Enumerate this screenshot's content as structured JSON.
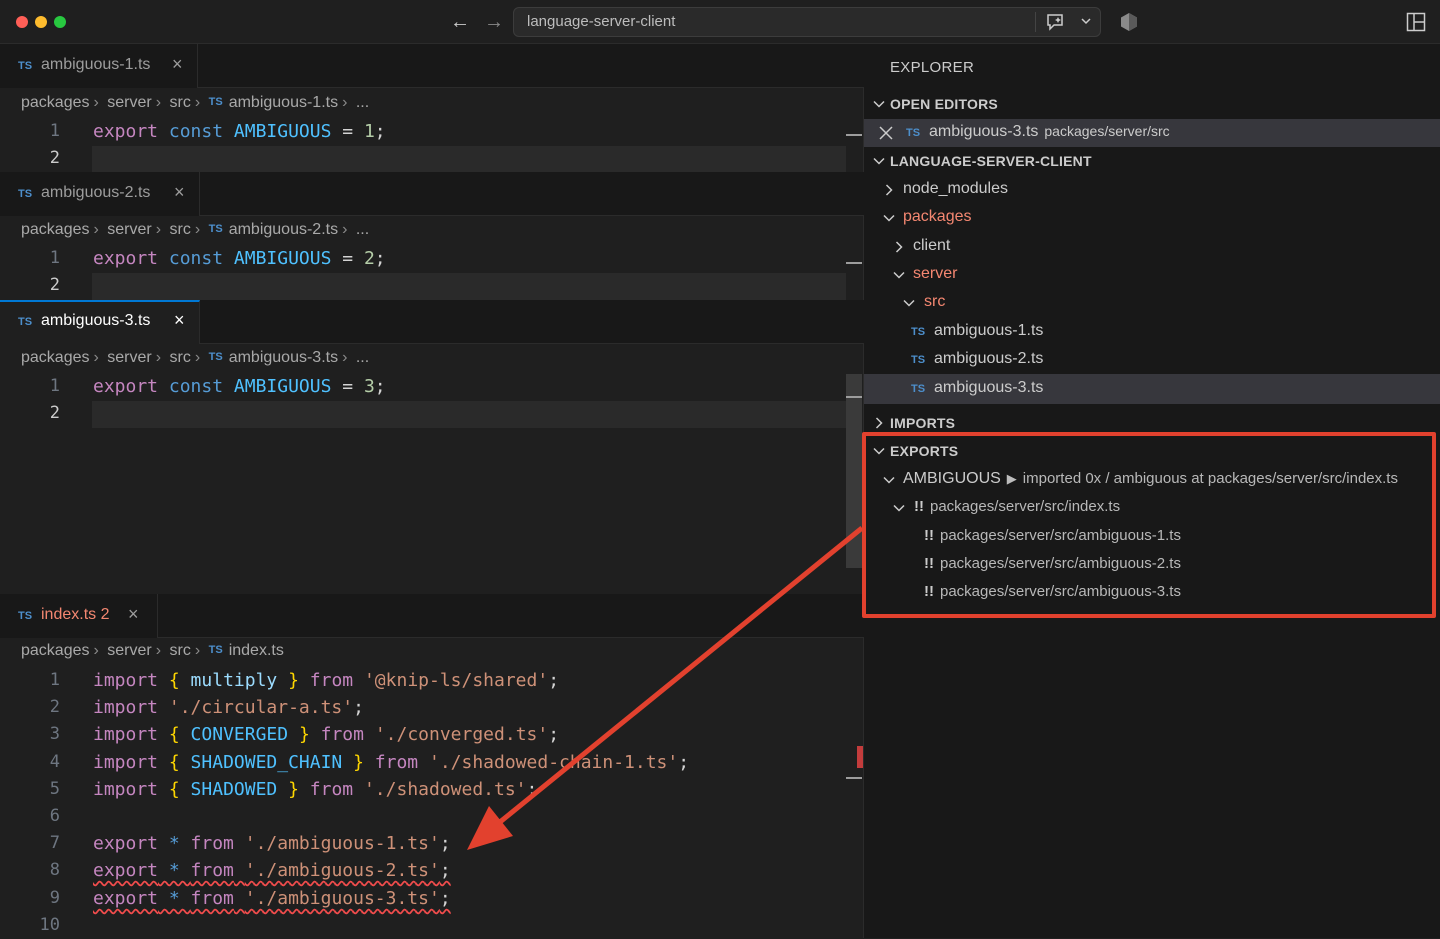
{
  "window": {
    "command_center_text": "language-server-client"
  },
  "editors": [
    {
      "tab_label": "ambiguous-1.ts",
      "breadcrumb": [
        "packages",
        "server",
        "src",
        "ambiguous-1.ts",
        "..."
      ],
      "lines": [
        {
          "num": "1",
          "tokens": [
            [
              "export",
              "kw-purple"
            ],
            [
              " const ",
              "kw-blue"
            ],
            [
              "AMBIGUOUS",
              "const-name"
            ],
            [
              " = ",
              "punct"
            ],
            [
              "1",
              "num"
            ],
            [
              ";",
              "punct"
            ]
          ]
        },
        {
          "num": "2",
          "tokens": []
        }
      ]
    },
    {
      "tab_label": "ambiguous-2.ts",
      "breadcrumb": [
        "packages",
        "server",
        "src",
        "ambiguous-2.ts",
        "..."
      ],
      "lines": [
        {
          "num": "1",
          "tokens": [
            [
              "export",
              "kw-purple"
            ],
            [
              " const ",
              "kw-blue"
            ],
            [
              "AMBIGUOUS",
              "const-name"
            ],
            [
              " = ",
              "punct"
            ],
            [
              "2",
              "num"
            ],
            [
              ";",
              "punct"
            ]
          ]
        },
        {
          "num": "2",
          "tokens": []
        }
      ]
    },
    {
      "tab_label": "ambiguous-3.ts",
      "breadcrumb": [
        "packages",
        "server",
        "src",
        "ambiguous-3.ts",
        "..."
      ],
      "lines": [
        {
          "num": "1",
          "tokens": [
            [
              "export",
              "kw-purple"
            ],
            [
              " const ",
              "kw-blue"
            ],
            [
              "AMBIGUOUS",
              "const-name"
            ],
            [
              " = ",
              "punct"
            ],
            [
              "3",
              "num"
            ],
            [
              ";",
              "punct"
            ]
          ]
        },
        {
          "num": "2",
          "tokens": []
        }
      ]
    },
    {
      "tab_label": "index.ts",
      "tab_problems": "2",
      "breadcrumb": [
        "packages",
        "server",
        "src",
        "index.ts"
      ],
      "lines": [
        {
          "num": "1",
          "tokens": [
            [
              "import",
              "kw-purple"
            ],
            [
              " ",
              "punct"
            ],
            [
              "{",
              "brace"
            ],
            [
              " multiply ",
              "ident"
            ],
            [
              "}",
              "brace"
            ],
            [
              " from ",
              "kw-purple"
            ],
            [
              "'@knip-ls/shared'",
              "str"
            ],
            [
              ";",
              "punct"
            ]
          ]
        },
        {
          "num": "2",
          "tokens": [
            [
              "import",
              "kw-purple"
            ],
            [
              " ",
              "punct"
            ],
            [
              "'./circular-a.ts'",
              "str"
            ],
            [
              ";",
              "punct"
            ]
          ]
        },
        {
          "num": "3",
          "tokens": [
            [
              "import",
              "kw-purple"
            ],
            [
              " ",
              "punct"
            ],
            [
              "{",
              "brace"
            ],
            [
              " CONVERGED ",
              "const-name"
            ],
            [
              "}",
              "brace"
            ],
            [
              " from ",
              "kw-purple"
            ],
            [
              "'./converged.ts'",
              "str"
            ],
            [
              ";",
              "punct"
            ]
          ]
        },
        {
          "num": "4",
          "tokens": [
            [
              "import",
              "kw-purple"
            ],
            [
              " ",
              "punct"
            ],
            [
              "{",
              "brace"
            ],
            [
              " SHADOWED_CHAIN ",
              "const-name"
            ],
            [
              "}",
              "brace"
            ],
            [
              " from ",
              "kw-purple"
            ],
            [
              "'./shadowed-chain-1.ts'",
              "str"
            ],
            [
              ";",
              "punct"
            ]
          ]
        },
        {
          "num": "5",
          "tokens": [
            [
              "import",
              "kw-purple"
            ],
            [
              " ",
              "punct"
            ],
            [
              "{",
              "brace"
            ],
            [
              " SHADOWED ",
              "const-name"
            ],
            [
              "}",
              "brace"
            ],
            [
              " from ",
              "kw-purple"
            ],
            [
              "'./shadowed.ts'",
              "str"
            ],
            [
              ";",
              "punct"
            ]
          ]
        },
        {
          "num": "6",
          "tokens": []
        },
        {
          "num": "7",
          "tokens": [
            [
              "export",
              "kw-purple"
            ],
            [
              " * ",
              "kw-blue"
            ],
            [
              "from",
              "kw-purple"
            ],
            [
              " ",
              "punct"
            ],
            [
              "'./ambiguous-1.ts'",
              "str"
            ],
            [
              ";",
              "punct"
            ]
          ]
        },
        {
          "num": "8",
          "squiggly": true,
          "tokens": [
            [
              "export",
              "kw-purple"
            ],
            [
              " * ",
              "kw-blue"
            ],
            [
              "from",
              "kw-purple"
            ],
            [
              " ",
              "punct"
            ],
            [
              "'./ambiguous-2.ts'",
              "str"
            ],
            [
              ";",
              "punct"
            ]
          ]
        },
        {
          "num": "9",
          "squiggly": true,
          "tokens": [
            [
              "export",
              "kw-purple"
            ],
            [
              " * ",
              "kw-blue"
            ],
            [
              "from",
              "kw-purple"
            ],
            [
              " ",
              "punct"
            ],
            [
              "'./ambiguous-3.ts'",
              "str"
            ],
            [
              ";",
              "punct"
            ]
          ]
        },
        {
          "num": "10",
          "tokens": []
        }
      ]
    }
  ],
  "explorer": {
    "title": "EXPLORER",
    "open_editors": {
      "heading": "OPEN EDITORS",
      "item_label": "ambiguous-3.ts",
      "item_desc": "packages/server/src"
    },
    "workspace": {
      "heading": "LANGUAGE-SERVER-CLIENT",
      "items": [
        {
          "label": "node_modules",
          "kind": "folder-collapsed"
        },
        {
          "label": "packages",
          "kind": "folder-expanded"
        },
        {
          "label": "client",
          "kind": "folder-collapsed"
        },
        {
          "label": "server",
          "kind": "folder-expanded"
        },
        {
          "label": "src",
          "kind": "folder-expanded"
        },
        {
          "label": "ambiguous-1.ts",
          "kind": "file"
        },
        {
          "label": "ambiguous-2.ts",
          "kind": "file"
        },
        {
          "label": "ambiguous-3.ts",
          "kind": "file"
        }
      ]
    },
    "imports": {
      "heading": "IMPORTS"
    },
    "exports": {
      "heading": "EXPORTS",
      "symbol": "AMBIGUOUS",
      "symbol_detail": "imported 0x / ambiguous at packages/server/src/index.ts",
      "entry": "packages/server/src/index.ts",
      "children": [
        "packages/server/src/ambiguous-1.ts",
        "packages/server/src/ambiguous-2.ts",
        "packages/server/src/ambiguous-3.ts"
      ],
      "bang": "!!"
    }
  },
  "colors": {
    "annotation": "#e2412e",
    "accent": "#0078d4"
  }
}
